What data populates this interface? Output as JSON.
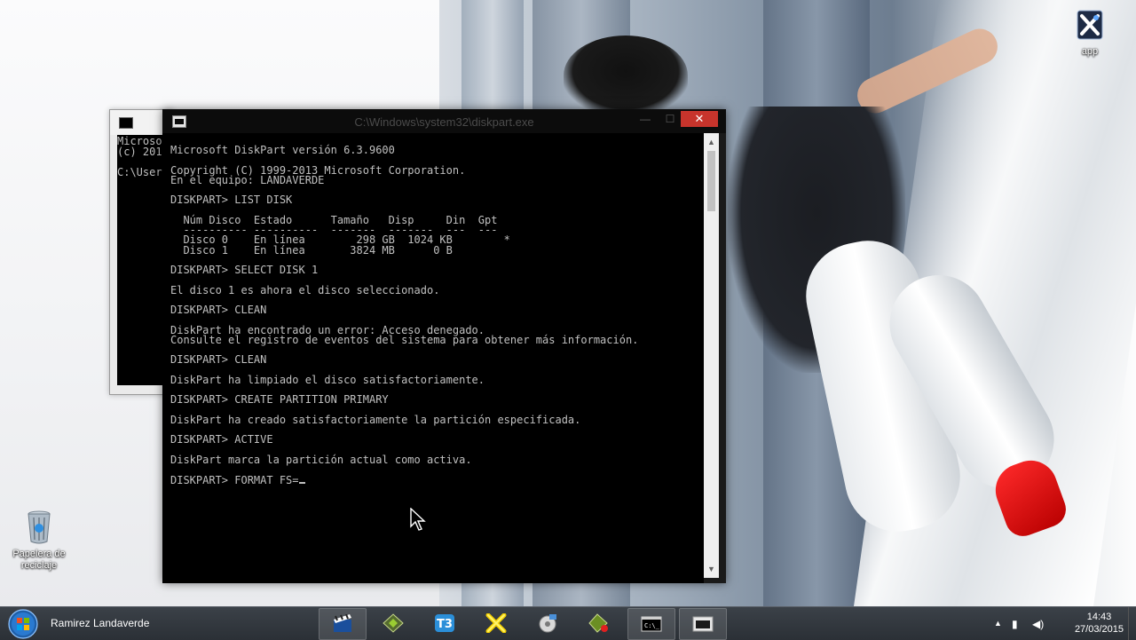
{
  "desktop": {
    "icons": [
      {
        "label": "app"
      },
      {
        "label": "Papelera de reciclaje"
      }
    ]
  },
  "background_window": {
    "lines": [
      "Microso",
      "(c) 201",
      "",
      "C:\\User"
    ]
  },
  "window": {
    "title": "C:\\Windows\\system32\\diskpart.exe",
    "minimize": "—",
    "maximize": "☐",
    "close": "✕",
    "console_lines": [
      "Microsoft DiskPart versión 6.3.9600",
      "",
      "Copyright (C) 1999-2013 Microsoft Corporation.",
      "En el equipo: LANDAVERDE",
      "",
      "DISKPART> LIST DISK",
      "",
      "  Núm Disco  Estado      Tamaño   Disp     Din  Gpt",
      "  ---------- ----------  -------  -------  ---  ---",
      "  Disco 0    En línea        298 GB  1024 KB        *",
      "  Disco 1    En línea       3824 MB      0 B",
      "",
      "DISKPART> SELECT DISK 1",
      "",
      "El disco 1 es ahora el disco seleccionado.",
      "",
      "DISKPART> CLEAN",
      "",
      "DiskPart ha encontrado un error: Acceso denegado.",
      "Consulte el registro de eventos del sistema para obtener más información.",
      "",
      "DISKPART> CLEAN",
      "",
      "DiskPart ha limpiado el disco satisfactoriamente.",
      "",
      "DISKPART> CREATE PARTITION PRIMARY",
      "",
      "DiskPart ha creado satisfactoriamente la partición especificada.",
      "",
      "DISKPART> ACTIVE",
      "",
      "DiskPart marca la partición actual como activa.",
      ""
    ],
    "prompt_line": "DISKPART> FORMAT FS="
  },
  "taskbar": {
    "user_name": "Ramirez Landaverde",
    "apps": [
      {
        "icon": "media-app-icon",
        "active": true
      },
      {
        "icon": "green-app-icon",
        "active": false
      },
      {
        "icon": "t3-app-icon",
        "active": false
      },
      {
        "icon": "yellow-x-app-icon",
        "active": false
      },
      {
        "icon": "disk-utility-icon",
        "active": false
      },
      {
        "icon": "recorder-app-icon",
        "active": false
      },
      {
        "icon": "cmd-app-icon",
        "active": true
      },
      {
        "icon": "diskpart-app-icon",
        "active": true
      }
    ],
    "time": "14:43",
    "date": "27/03/2015"
  },
  "colors": {
    "console_text": "#c0c0c0",
    "close_button": "#c7342c",
    "taskbar": "#2f343a"
  }
}
